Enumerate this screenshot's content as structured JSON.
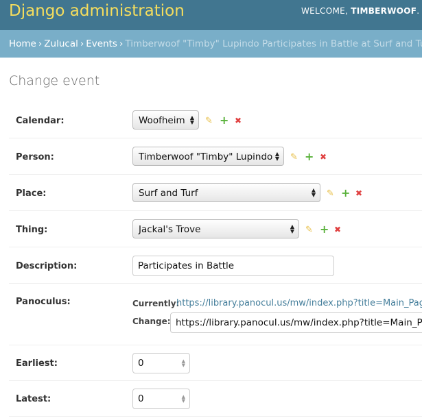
{
  "header": {
    "site_title": "Django administration",
    "welcome": "WELCOME,",
    "username": "TIMBERWOOF",
    "username_suffix": "."
  },
  "breadcrumbs": {
    "items": [
      "Home",
      "Zulucal",
      "Events"
    ],
    "current": "Timberwoof \"Timby\" Lupindo Participates in Battle at Surf and Turf with",
    "separator": "›"
  },
  "page_title": "Change event",
  "form": {
    "calendar": {
      "label": "Calendar:",
      "value": "Woofheim"
    },
    "person": {
      "label": "Person:",
      "value": "Timberwoof \"Timby\" Lupindo"
    },
    "place": {
      "label": "Place:",
      "value": "Surf and Turf"
    },
    "thing": {
      "label": "Thing:",
      "value": "Jackal's Trove"
    },
    "description": {
      "label": "Description:",
      "value": "Participates in Battle"
    },
    "panoculus": {
      "label": "Panoculus:",
      "currently_label": "Currently:",
      "currently_url": "https://library.panocul.us/mw/index.php?title=Main_Page",
      "change_label": "Change:",
      "change_value": "https://library.panocul.us/mw/index.php?title=Main_Page"
    },
    "earliest": {
      "label": "Earliest:",
      "value": "0"
    },
    "latest": {
      "label": "Latest:",
      "value": "0"
    }
  },
  "icons": {
    "edit": "pencil-icon",
    "add": "plus-icon",
    "delete": "cross-icon"
  },
  "colors": {
    "header_bg": "#417690",
    "site_title": "#f5dd5d",
    "breadcrumb_bg": "#79aec8",
    "link": "#447e9b",
    "add": "#5ab23c",
    "delete": "#e04040",
    "edit": "#e8c04b"
  }
}
